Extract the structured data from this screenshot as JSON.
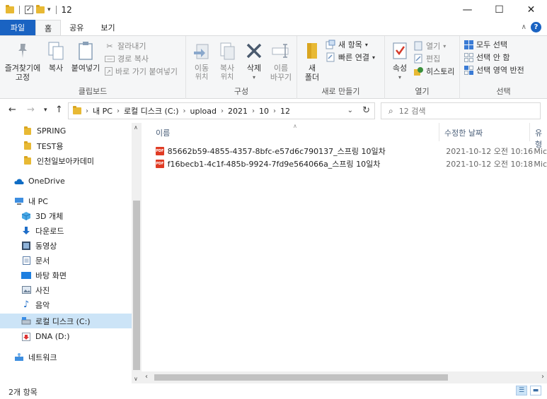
{
  "window": {
    "title": "12",
    "minimize": "—",
    "maximize": "☐",
    "close": "✕"
  },
  "ribbon_tabs": [
    "파일",
    "홈",
    "공유",
    "보기"
  ],
  "ribbon": {
    "clipboard": {
      "label": "클립보드",
      "pin_line1": "즐겨찾기에",
      "pin_line2": "고정",
      "copy": "복사",
      "paste": "붙여넣기",
      "cut": "잘라내기",
      "copy_path": "경로 복사",
      "paste_shortcut": "바로 가기 붙여넣기"
    },
    "organize": {
      "label": "구성",
      "move_line1": "이동",
      "move_line2": "위치",
      "copyto_line1": "복사",
      "copyto_line2": "위치",
      "delete": "삭제",
      "rename_line1": "이름",
      "rename_line2": "바꾸기"
    },
    "new": {
      "label": "새로 만들기",
      "newfolder_line1": "새",
      "newfolder_line2": "폴더",
      "new_item": "새 항목",
      "easy_access": "빠른 연결"
    },
    "open": {
      "label": "열기",
      "properties": "속성",
      "open": "열기",
      "edit": "편집",
      "history": "히스토리"
    },
    "select": {
      "label": "선택",
      "select_all": "모두 선택",
      "select_none": "선택 안 함",
      "invert": "선택 영역 반전"
    }
  },
  "address": {
    "crumbs": [
      "내 PC",
      "로컬 디스크 (C:)",
      "upload",
      "2021",
      "10",
      "12"
    ]
  },
  "search": {
    "placeholder": "12 검색"
  },
  "nav_pane": {
    "items": [
      {
        "label": "SPRING",
        "icon": "folder-icon"
      },
      {
        "label": "TEST용",
        "icon": "folder-icon"
      },
      {
        "label": "인천일보아카데미",
        "icon": "folder-icon"
      },
      {
        "label": "OneDrive",
        "icon": "cloud-icon"
      },
      {
        "label": "내 PC",
        "icon": "pc-icon"
      },
      {
        "label": "3D 개체",
        "icon": "cube-icon"
      },
      {
        "label": "다운로드",
        "icon": "download-icon"
      },
      {
        "label": "동영상",
        "icon": "video-icon"
      },
      {
        "label": "문서",
        "icon": "document-icon"
      },
      {
        "label": "바탕 화면",
        "icon": "desktop-icon"
      },
      {
        "label": "사진",
        "icon": "picture-icon"
      },
      {
        "label": "음악",
        "icon": "music-icon"
      },
      {
        "label": "로컬 디스크 (C:)",
        "icon": "drive-icon"
      },
      {
        "label": "DNA (D:)",
        "icon": "drive-icon"
      },
      {
        "label": "네트워크",
        "icon": "network-icon"
      }
    ]
  },
  "columns": {
    "name": "이름",
    "modified": "수정한 날짜",
    "type": "유형"
  },
  "files": [
    {
      "name": "85662b59-4855-4357-8bfc-e57d6c790137_스프링 10일차",
      "modified": "2021-10-12 오전 10:16",
      "type": "Mic"
    },
    {
      "name": "f16becb1-4c1f-485b-9924-7fd9e564066a_스프링 10일차",
      "modified": "2021-10-12 오전 10:18",
      "type": "Mic"
    }
  ],
  "status": {
    "count": "2개 항목"
  },
  "colors": {
    "accent": "#1a63c2",
    "folder": "#e8b934",
    "selected": "#cce4f7",
    "pdf": "#e03b24"
  }
}
